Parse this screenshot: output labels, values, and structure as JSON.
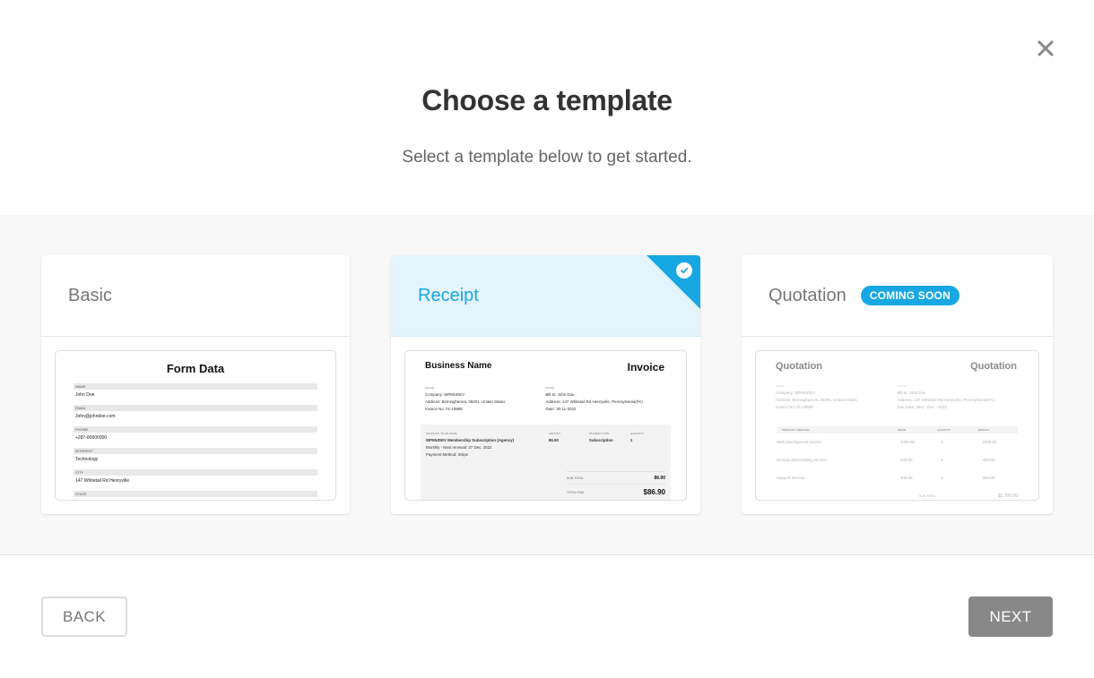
{
  "dialog": {
    "title": "Choose a template",
    "subtitle": "Select a template below to get started.",
    "close_icon": "close-icon"
  },
  "templates": [
    {
      "name": "Basic",
      "selected": false,
      "preview": {
        "title": "Form Data",
        "fields": [
          {
            "label": "NAME",
            "value": "John Doe"
          },
          {
            "label": "EMAIL",
            "value": "John@johndoe.com"
          },
          {
            "label": "PHONE",
            "value": "+287-80000000"
          },
          {
            "label": "INTEREST",
            "value": "Technology"
          },
          {
            "label": "CITY",
            "value": "147 Whitetail Rd Henryville"
          },
          {
            "label": "STATE",
            "value": ""
          }
        ]
      }
    },
    {
      "name": "Receipt",
      "selected": true,
      "preview": {
        "business": "Business Name",
        "doc_title": "Invoice",
        "biller_label": "BILLER",
        "payer_label": "PAYER",
        "biller_lines": [
          "Company: WPMUDEV",
          "Address: BirminghamAL 35201, United States",
          "Invoice No: 01-19988"
        ],
        "payer_lines": [
          "Bill to: John Doe",
          "Address: 147 Whitetail Rd Henryville, Pennsylvania(PA)",
          "Date: 30-11-2022"
        ],
        "table_headers": [
          "PRODUCT / PLAN NAME",
          "AMOUNT",
          "PAYMENT TYPE",
          "QUANTITY"
        ],
        "item_lines": [
          "WPMUDEV Membership Subscription (Agency)",
          "Monthly - Next renewal: 27 Dec, 2022",
          "Payment Method: Stripe"
        ],
        "item_amount": "86.90",
        "item_type": "Subscription",
        "item_qty": "1",
        "subtotal_label": "SUB-TOTAL",
        "subtotal_value": "86.90",
        "total_label": "TOTAL PAID",
        "total_value": "$86.90"
      }
    },
    {
      "name": "Quotation",
      "selected": false,
      "badge": "COMING SOON",
      "preview": {
        "business": "Quotation",
        "doc_title": "Quotation",
        "biller_label": "BILLER",
        "payer_label": "PAYER",
        "biller_lines": [
          "Company: WPMUDEV",
          "Address: Birmingham,AL 35201, United States",
          "Invoice No: 01-19988"
        ],
        "payer_lines": [
          "Bill to: John Doe",
          "Address: 147 Whitetail Rd Henryville, Pennsylvania(PA)",
          "Due Date: 30rd - Dec - 2022"
        ],
        "table_headers": [
          "PRODUCT / SERVICE",
          "PRICE",
          "QUANTITY",
          "AMOUNT"
        ],
        "rows": [
          {
            "name": "Web development service",
            "price": "1000.00",
            "qty": "1",
            "amount": "1000.00"
          },
          {
            "name": "Domain and Hosting Service",
            "price": "200.00",
            "qty": "2",
            "amount": "400.00"
          },
          {
            "name": "Support Service",
            "price": "300.00",
            "qty": "1",
            "amount": "300.00"
          }
        ],
        "subtotal_label": "SUB-TOTAL",
        "subtotal_value": "$1,700.00"
      }
    }
  ],
  "footer": {
    "back_label": "BACK",
    "next_label": "NEXT"
  },
  "colors": {
    "accent": "#17a8e3",
    "selected_bg": "#e3f4fc",
    "next_button": "#888888"
  }
}
